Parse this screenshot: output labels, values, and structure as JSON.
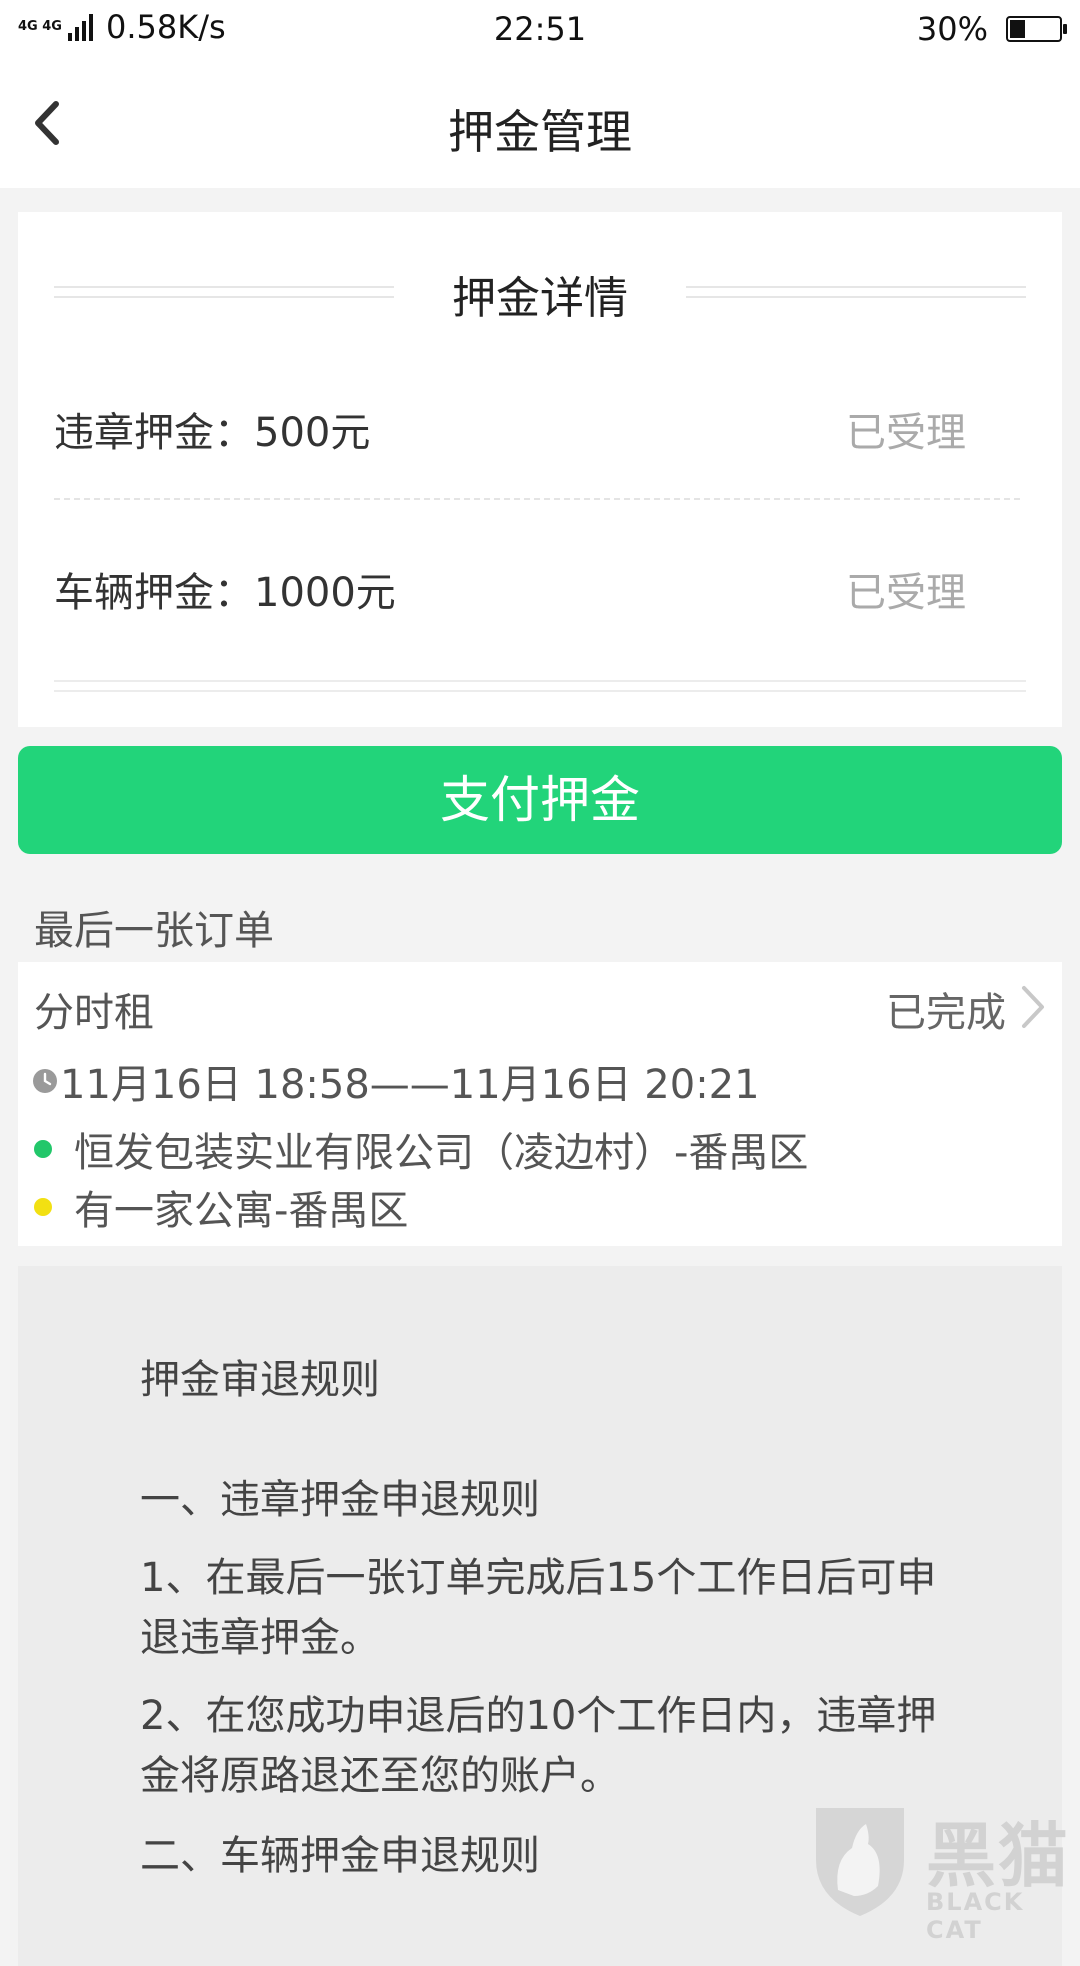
{
  "status_bar": {
    "network": "4G 4G",
    "speed": "0.58K/s",
    "time": "22:51",
    "battery": "30%"
  },
  "nav": {
    "title": "押金管理"
  },
  "deposit_details": {
    "heading": "押金详情",
    "rows": [
      {
        "label": "违章押金：500元",
        "status": "已受理"
      },
      {
        "label": "车辆押金：1000元",
        "status": "已受理"
      }
    ]
  },
  "pay_button": {
    "label": "支付押金"
  },
  "last_order": {
    "section_title": "最后一张订单",
    "type": "分时租",
    "status": "已完成",
    "time_range": "11月16日 18:58——11月16日 20:21",
    "start_location": "恒发包装实业有限公司（凌边村）-番禺区",
    "end_location": "有一家公寓-番禺区",
    "start_dot_color": "#22c76a",
    "end_dot_color": "#f2e012"
  },
  "rules": {
    "title": "押金审退规则",
    "section1": "一、违章押金申退规则",
    "rule1": "1、在最后一张订单完成后15个工作日后可申退违章押金。",
    "rule2": "2、在您成功申退后的10个工作日内，违章押金将原路退还至您的账户。",
    "section2": "二、车辆押金申退规则"
  },
  "watermark": {
    "text": "黑猫",
    "sub": "BLACK CAT"
  },
  "colors": {
    "accent": "#22d47a"
  }
}
